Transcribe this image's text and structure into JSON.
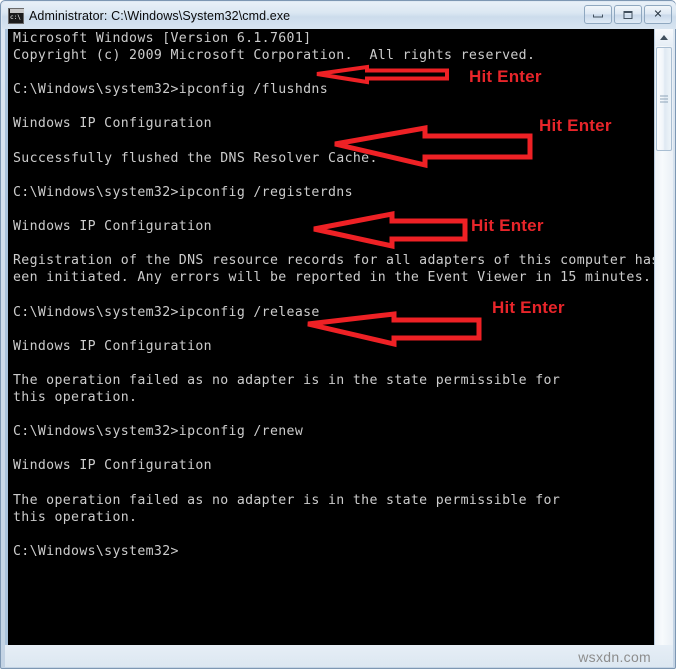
{
  "window": {
    "title": "Administrator: C:\\Windows\\System32\\cmd.exe",
    "icon": "cmd-console-icon",
    "buttons": {
      "minimize": "minimize",
      "maximize": "maximize",
      "close": "close"
    }
  },
  "console": {
    "background_color": "#000000",
    "text_color": "#cccccc",
    "lines": [
      "Microsoft Windows [Version 6.1.7601]",
      "Copyright (c) 2009 Microsoft Corporation.  All rights reserved.",
      "",
      "C:\\Windows\\system32>ipconfig /flushdns",
      "",
      "Windows IP Configuration",
      "",
      "Successfully flushed the DNS Resolver Cache.",
      "",
      "C:\\Windows\\system32>ipconfig /registerdns",
      "",
      "Windows IP Configuration",
      "",
      "Registration of the DNS resource records for all adapters of this computer has b",
      "een initiated. Any errors will be reported in the Event Viewer in 15 minutes.",
      "",
      "C:\\Windows\\system32>ipconfig /release",
      "",
      "Windows IP Configuration",
      "",
      "The operation failed as no adapter is in the state permissible for",
      "this operation.",
      "",
      "C:\\Windows\\system32>ipconfig /renew",
      "",
      "Windows IP Configuration",
      "",
      "The operation failed as no adapter is in the state permissible for",
      "this operation.",
      "",
      "C:\\Windows\\system32>"
    ]
  },
  "annotations": {
    "color": "#ee2125",
    "items": [
      {
        "label": "Hit Enter",
        "command": "ipconfig /flushdns"
      },
      {
        "label": "Hit Enter",
        "command": "ipconfig /registerdns"
      },
      {
        "label": "Hit Enter",
        "command": "ipconfig /release"
      },
      {
        "label": "Hit Enter",
        "command": "ipconfig /renew"
      }
    ]
  },
  "scrollbar": {
    "up_arrow": "scroll-up-arrow",
    "down_arrow": "scroll-down-arrow",
    "thumb": "scroll-thumb"
  },
  "watermark": {
    "text": "wsxdn.com"
  }
}
